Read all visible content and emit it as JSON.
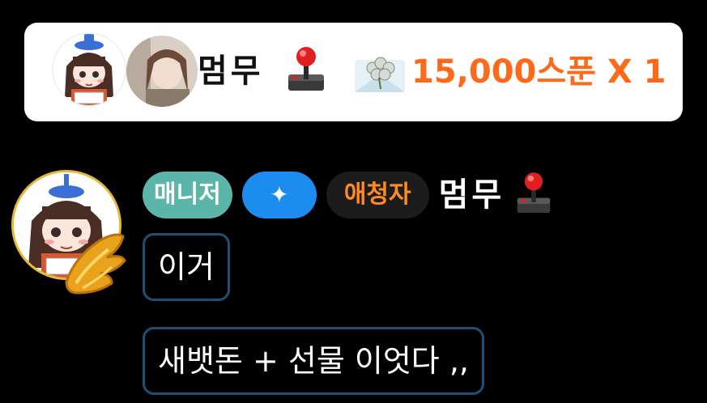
{
  "banner": {
    "user_name": "멈무",
    "name_icon": "joystick-icon",
    "gift_icon": "star-balloon-gift-icon",
    "gift_amount": "15,000스푼 X 1",
    "amount_color": "#ff6a1a"
  },
  "chat": {
    "badges": {
      "manager": "매니저",
      "star": "✦",
      "fan": "애청자"
    },
    "user_name": "멈무",
    "name_icon": "joystick-icon",
    "avatar_badge_icon": "gold-wing-icon",
    "messages": [
      "이거",
      "새뱃돈 + 선물 이엇다 ,,"
    ]
  },
  "colors": {
    "background": "#000000",
    "manager_badge": "#5bb5a8",
    "star_badge": "#1d8cf0",
    "fan_badge_text": "#ff8a1f",
    "bubble_border": "#1f4f74",
    "avatar_ring": "#e5b93a"
  }
}
